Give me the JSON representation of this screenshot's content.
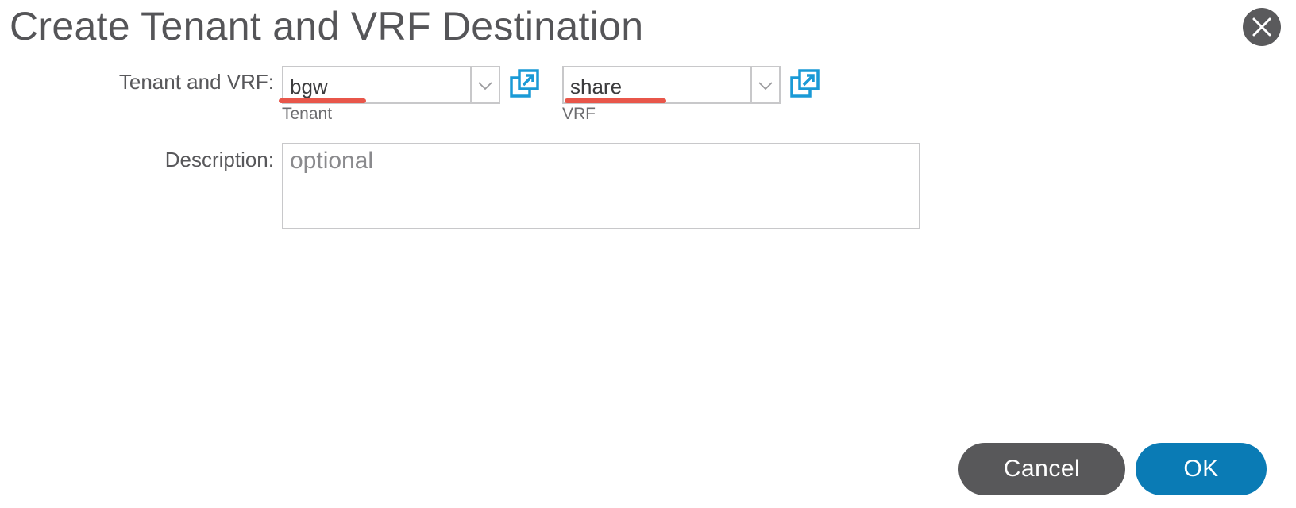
{
  "dialog": {
    "title": "Create Tenant and VRF Destination"
  },
  "form": {
    "tenant_vrf_label": "Tenant and VRF:",
    "tenant": {
      "value": "bgw",
      "sublabel": "Tenant"
    },
    "vrf": {
      "value": "share",
      "sublabel": "VRF"
    },
    "description_label": "Description:",
    "description": {
      "value": "",
      "placeholder": "optional"
    }
  },
  "buttons": {
    "cancel_label": "Cancel",
    "ok_label": "OK"
  },
  "icons": {
    "close": "close-icon",
    "dropdown": "chevron-down-icon",
    "open_external": "open-in-new-window-icon"
  },
  "colors": {
    "accent": "#0a7bb5",
    "icon_blue": "#1a9ad6",
    "annotation_underline": "#e8564a",
    "cancel_bg": "#58585a"
  }
}
